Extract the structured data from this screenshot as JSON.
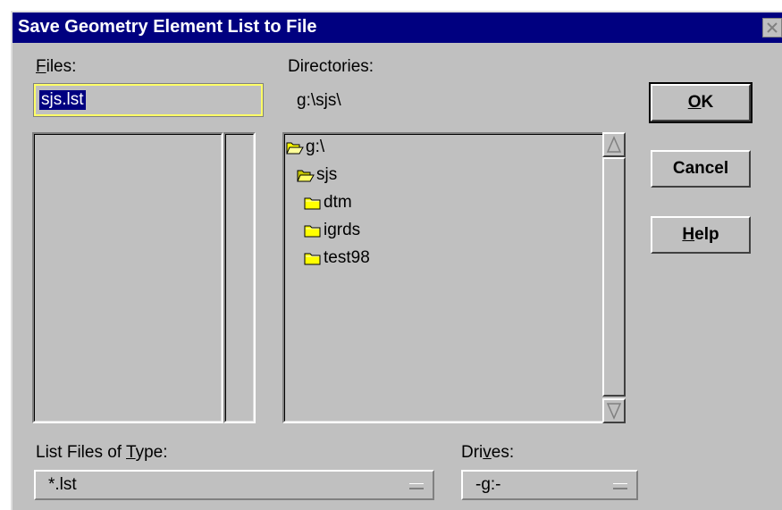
{
  "dialog": {
    "title": "Save Geometry Element List to File",
    "close_icon": "close-icon"
  },
  "files": {
    "label_mnemonic": "F",
    "label_rest": "iles:",
    "filename_value": "sjs.lst",
    "list_items": []
  },
  "directories": {
    "label": "Directories:",
    "current_path": "g:\\sjs\\",
    "tree": [
      {
        "name": "g:\\",
        "icon": "open-folder-icon",
        "indent": 0
      },
      {
        "name": "sjs",
        "icon": "open-folder-icon",
        "indent": 1
      },
      {
        "name": "dtm",
        "icon": "folder-icon",
        "indent": 2
      },
      {
        "name": "igrds",
        "icon": "folder-icon",
        "indent": 2
      },
      {
        "name": "test98",
        "icon": "folder-icon",
        "indent": 2
      }
    ]
  },
  "buttons": {
    "ok_mnemonic": "O",
    "ok_rest": "K",
    "cancel": "Cancel",
    "help_mnemonic": "H",
    "help_rest": "elp"
  },
  "file_type": {
    "label_pre": "List Files of ",
    "label_mnemonic": "T",
    "label_post": "ype:",
    "selected": "*.lst"
  },
  "drives": {
    "label_pre": "Dri",
    "label_mnemonic": "v",
    "label_post": "es:",
    "selected": "-g:-"
  }
}
